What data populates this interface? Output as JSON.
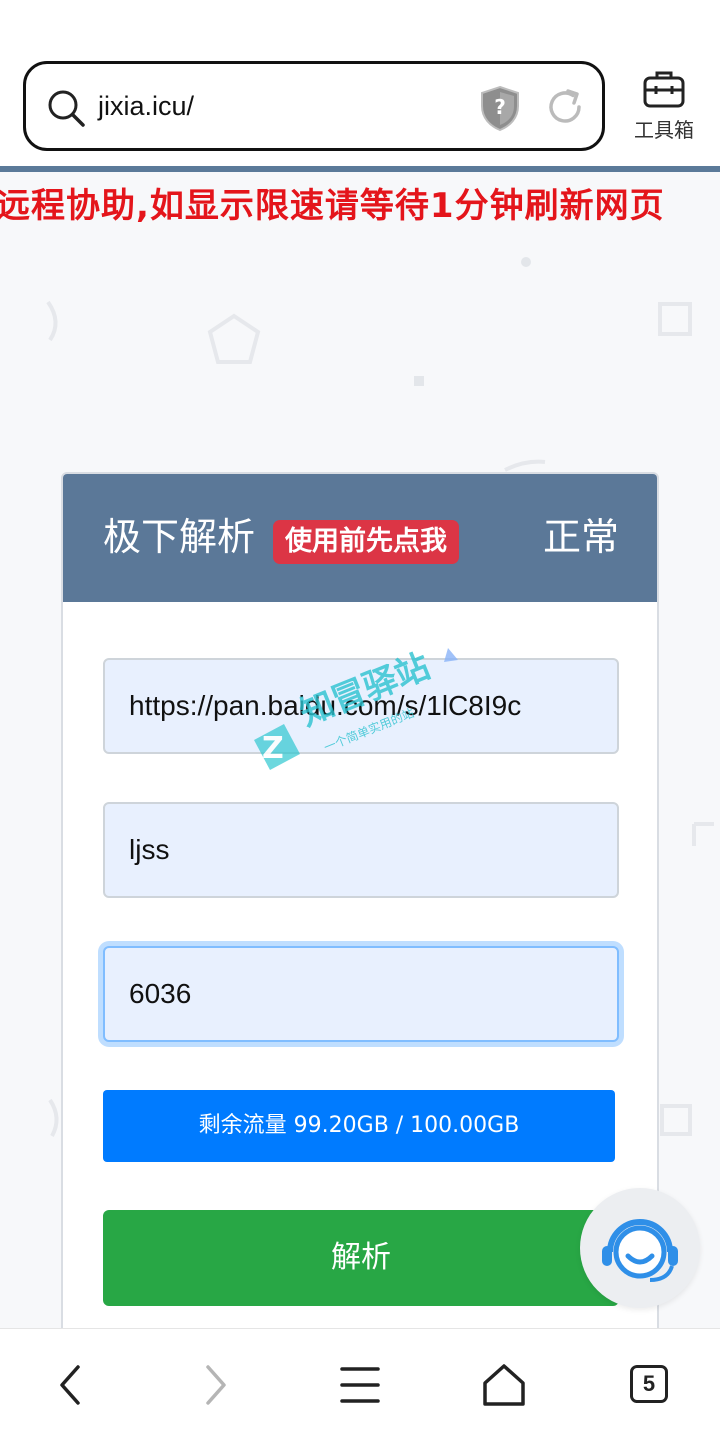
{
  "browser": {
    "url": "jixia.icu/",
    "toolbox_label": "工具箱",
    "tab_count": "5"
  },
  "marquee": {
    "text": "远程协助,如显示限速请等待1分钟刷新网页"
  },
  "card": {
    "title": "极下解析",
    "tip_badge": "使用前先点我",
    "status": "正常",
    "link_value": "https://pan.baidu.com/s/1lC8I9c",
    "code_value": "ljss",
    "captcha_value": "6036",
    "traffic": "剩余流量 99.20GB / 100.00GB",
    "parse_label": "解析"
  },
  "watermark": {
    "title": "知冒驿站",
    "subtitle": "一个简单实用的站"
  },
  "colors": {
    "header": "#5b7898",
    "badge": "#dc3545",
    "traffic": "#007bff",
    "parse": "#28a745",
    "marquee": "#e4151b"
  }
}
